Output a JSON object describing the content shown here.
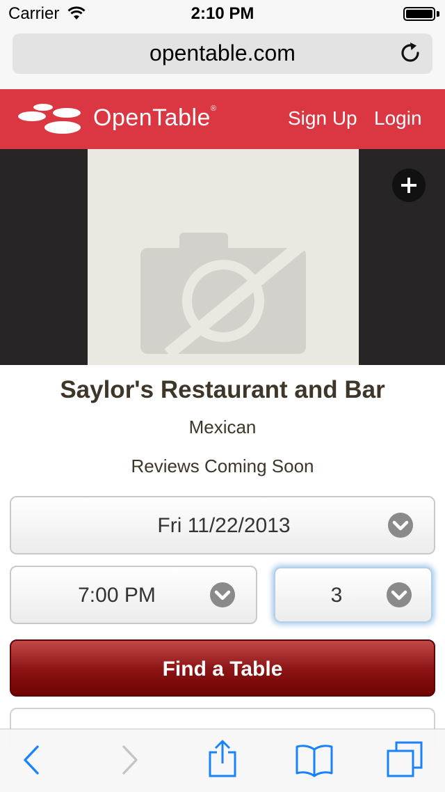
{
  "status_bar": {
    "carrier": "Carrier",
    "time": "2:10 PM"
  },
  "browser": {
    "url": "opentable.com"
  },
  "header": {
    "brand": "OpenTable",
    "brand_mark": "®",
    "sign_up": "Sign Up",
    "login": "Login",
    "color": "#da3743"
  },
  "restaurant": {
    "name": "Saylor's Restaurant and Bar",
    "cuisine": "Mexican",
    "reviews": "Reviews Coming Soon"
  },
  "reservation": {
    "date": "Fri 11/22/2013",
    "time": "7:00 PM",
    "party_size": "3",
    "find_button": "Find a Table"
  },
  "toolbar": {
    "icons": [
      "back-icon",
      "forward-icon",
      "share-icon",
      "bookmarks-icon",
      "tabs-icon"
    ]
  }
}
